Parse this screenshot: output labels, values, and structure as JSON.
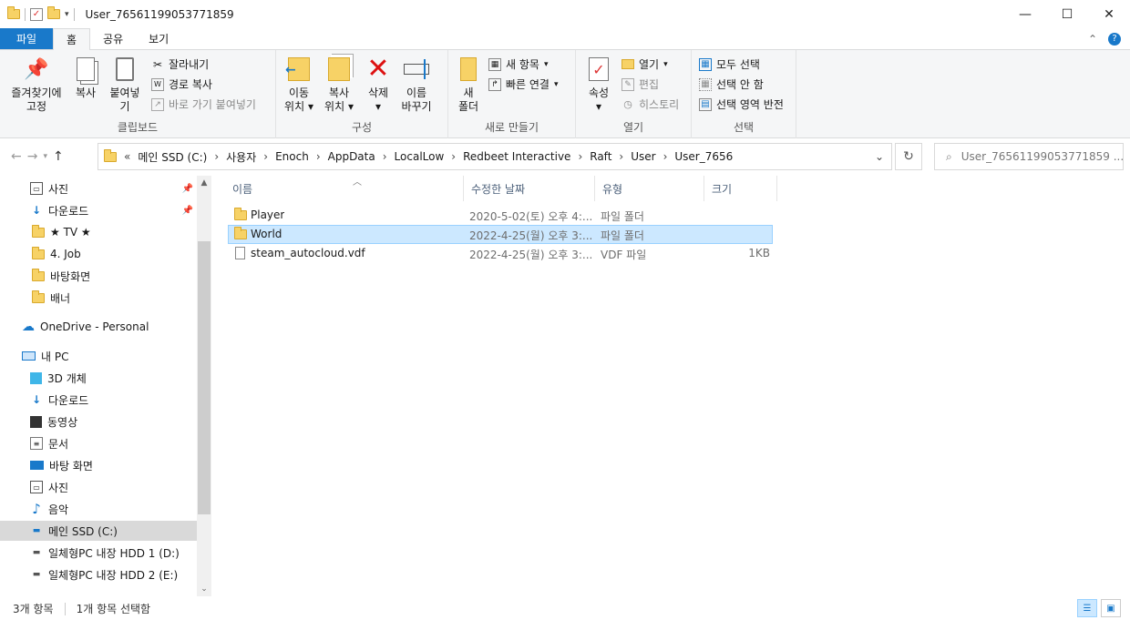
{
  "window": {
    "title": "User_76561199053771859",
    "controls": {
      "minimize": "—",
      "maximize": "☐",
      "close": "✕"
    }
  },
  "ribbon_tabs": [
    "파일",
    "홈",
    "공유",
    "보기"
  ],
  "ribbon": {
    "clipboard": {
      "label": "클립보드",
      "pin_line1": "즐겨찾기에",
      "pin_line2": "고정",
      "copy": "복사",
      "paste": "붙여넣기",
      "cut": "잘라내기",
      "copy_path": "경로 복사",
      "paste_shortcut": "바로 가기 붙여넣기"
    },
    "organize": {
      "label": "구성",
      "move_line1": "이동",
      "move_line2": "위치",
      "copy_line1": "복사",
      "copy_line2": "위치",
      "delete": "삭제",
      "rename_line1": "이름",
      "rename_line2": "바꾸기"
    },
    "new": {
      "label": "새로 만들기",
      "folder_line1": "새",
      "folder_line2": "폴더",
      "new_item": "새 항목",
      "easy_access": "빠른 연결"
    },
    "open": {
      "label": "열기",
      "properties": "속성",
      "open": "열기",
      "edit": "편집",
      "history": "히스토리"
    },
    "select": {
      "label": "선택",
      "select_all": "모두 선택",
      "select_none": "선택 안 함",
      "invert": "선택 영역 반전"
    }
  },
  "address": {
    "crumbs": [
      "메인 SSD (C:)",
      "사용자",
      "Enoch",
      "AppData",
      "LocalLow",
      "Redbeet Interactive",
      "Raft",
      "User",
      "User_7656"
    ],
    "search_placeholder": "User_76561199053771859 ..."
  },
  "nav_pane": {
    "quick_access": [
      {
        "label": "사진",
        "icon": "pictures-icon",
        "pinned": true
      },
      {
        "label": "다운로드",
        "icon": "download-icon",
        "pinned": true
      },
      {
        "label": "★ TV ★",
        "icon": "folder-icon"
      },
      {
        "label": "4. Job",
        "icon": "folder-icon"
      },
      {
        "label": "바탕화면",
        "icon": "folder-icon"
      },
      {
        "label": "배너",
        "icon": "folder-icon"
      }
    ],
    "onedrive": "OneDrive - Personal",
    "this_pc": "내 PC",
    "pc_items": [
      {
        "label": "3D 개체",
        "icon": "cube-icon"
      },
      {
        "label": "다운로드",
        "icon": "download-icon"
      },
      {
        "label": "동영상",
        "icon": "video-icon"
      },
      {
        "label": "문서",
        "icon": "document-icon"
      },
      {
        "label": "바탕 화면",
        "icon": "desktop-icon"
      },
      {
        "label": "사진",
        "icon": "pictures-icon"
      },
      {
        "label": "음악",
        "icon": "music-icon"
      },
      {
        "label": "메인 SSD (C:)",
        "icon": "drive-icon",
        "selected": true
      },
      {
        "label": "일체형PC 내장 HDD 1 (D:)",
        "icon": "drive-icon"
      },
      {
        "label": "일체형PC 내장 HDD 2 (E:)",
        "icon": "drive-icon"
      }
    ]
  },
  "columns": [
    "이름",
    "수정한 날짜",
    "유형",
    "크기"
  ],
  "files": [
    {
      "name": "Player",
      "modified": "2020-5-02(토) 오후 4:...",
      "type": "파일 폴더",
      "size": "",
      "kind": "folder"
    },
    {
      "name": "World",
      "modified": "2022-4-25(월) 오후 3:...",
      "type": "파일 폴더",
      "size": "",
      "kind": "folder",
      "selected": true
    },
    {
      "name": "steam_autocloud.vdf",
      "modified": "2022-4-25(월) 오후 3:...",
      "type": "VDF 파일",
      "size": "1KB",
      "kind": "file"
    }
  ],
  "status": {
    "count": "3개 항목",
    "selection": "1개 항목 선택함"
  }
}
